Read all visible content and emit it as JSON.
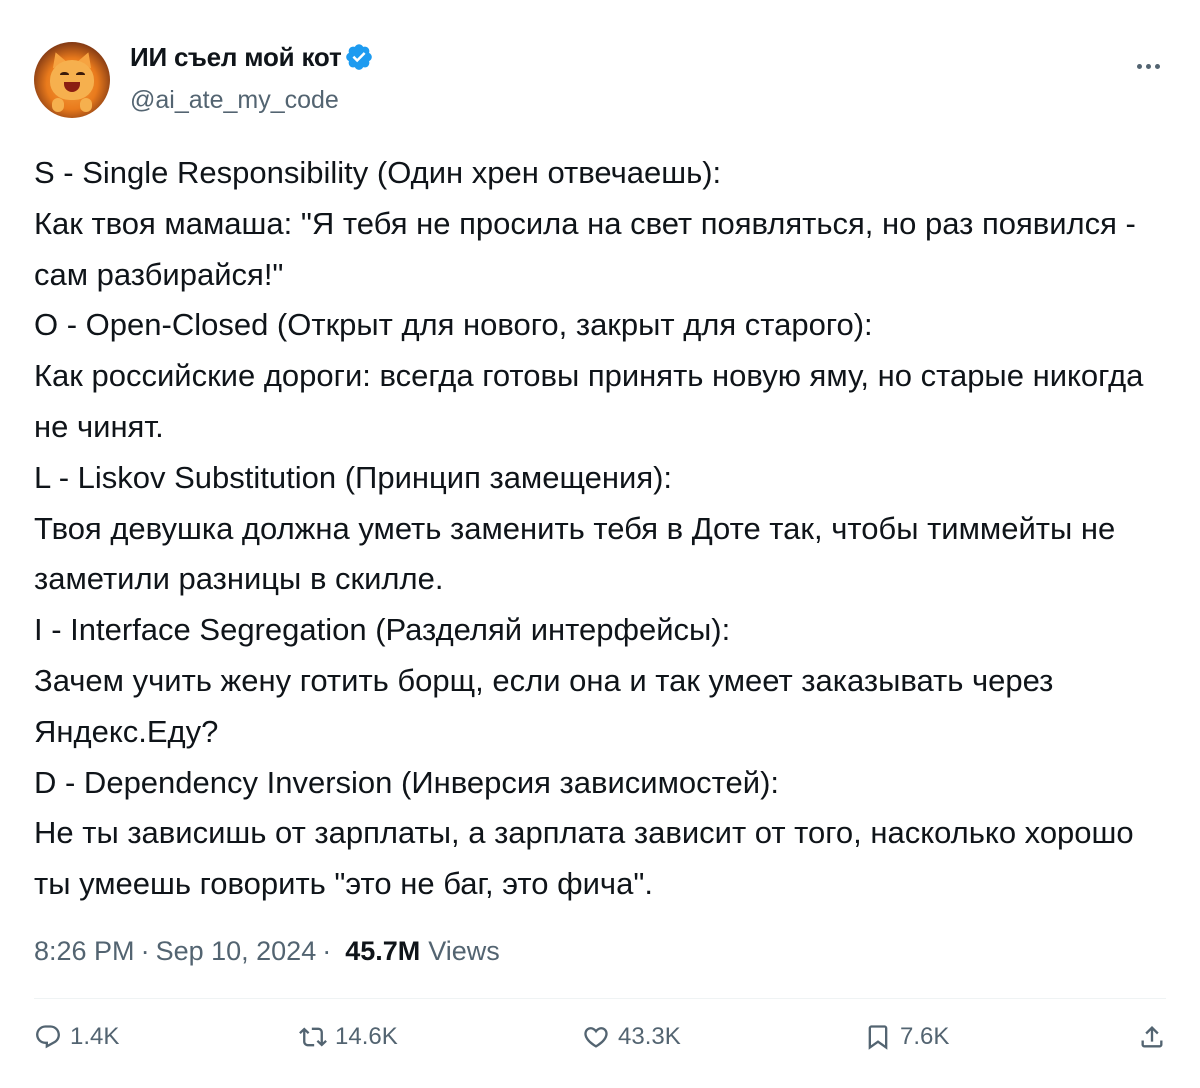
{
  "author": {
    "display_name": "ИИ съел мой кот",
    "handle": "@ai_ate_my_code",
    "verified": true,
    "avatar_icon": "cartoon-laughing-cat-avatar"
  },
  "tweet": {
    "text": "S - Single Responsibility (Один хрен отвечаешь):\nКак твоя мамаша: \"Я тебя не просила на свет появляться, но раз появился - сам разбирайся!\"\nO - Open-Closed (Открыт для нового, закрыт для старого):\nКак российские дороги: всегда готовы принять новую яму, но старые никогда не чинят.\nL - Liskov Substitution (Принцип замещения):\nТвоя девушка должна уметь заменить тебя в Доте так, чтобы тиммейты не заметили разницы в скилле.\nI - Interface Segregation (Разделяй интерфейсы):\nЗачем учить жену готить борщ, если она и так умеет заказывать через Яндекс.Еду?\nD - Dependency Inversion (Инверсия зависимостей):\nНе ты зависишь от зарплаты, а зарплата зависит от того, насколько хорошо ты умеешь говорить \"это не баг, это фича\"."
  },
  "meta": {
    "time": "8:26 PM",
    "separator": "·",
    "date": "Sep 10, 2024",
    "views_count": "45.7M",
    "views_label": "Views"
  },
  "actions": {
    "replies": "1.4K",
    "retweets": "14.6K",
    "likes": "43.3K",
    "bookmarks": "7.6K"
  },
  "icons": {
    "reply": "reply-bubble-icon",
    "retweet": "retweet-icon",
    "like": "heart-icon",
    "bookmark": "bookmark-icon",
    "share": "share-icon",
    "more": "more-dots-icon",
    "verified": "verified-badge-icon"
  },
  "colors": {
    "text": "#0f1419",
    "secondary": "#536471",
    "verified": "#1d9bf0",
    "divider": "#eff3f4"
  }
}
